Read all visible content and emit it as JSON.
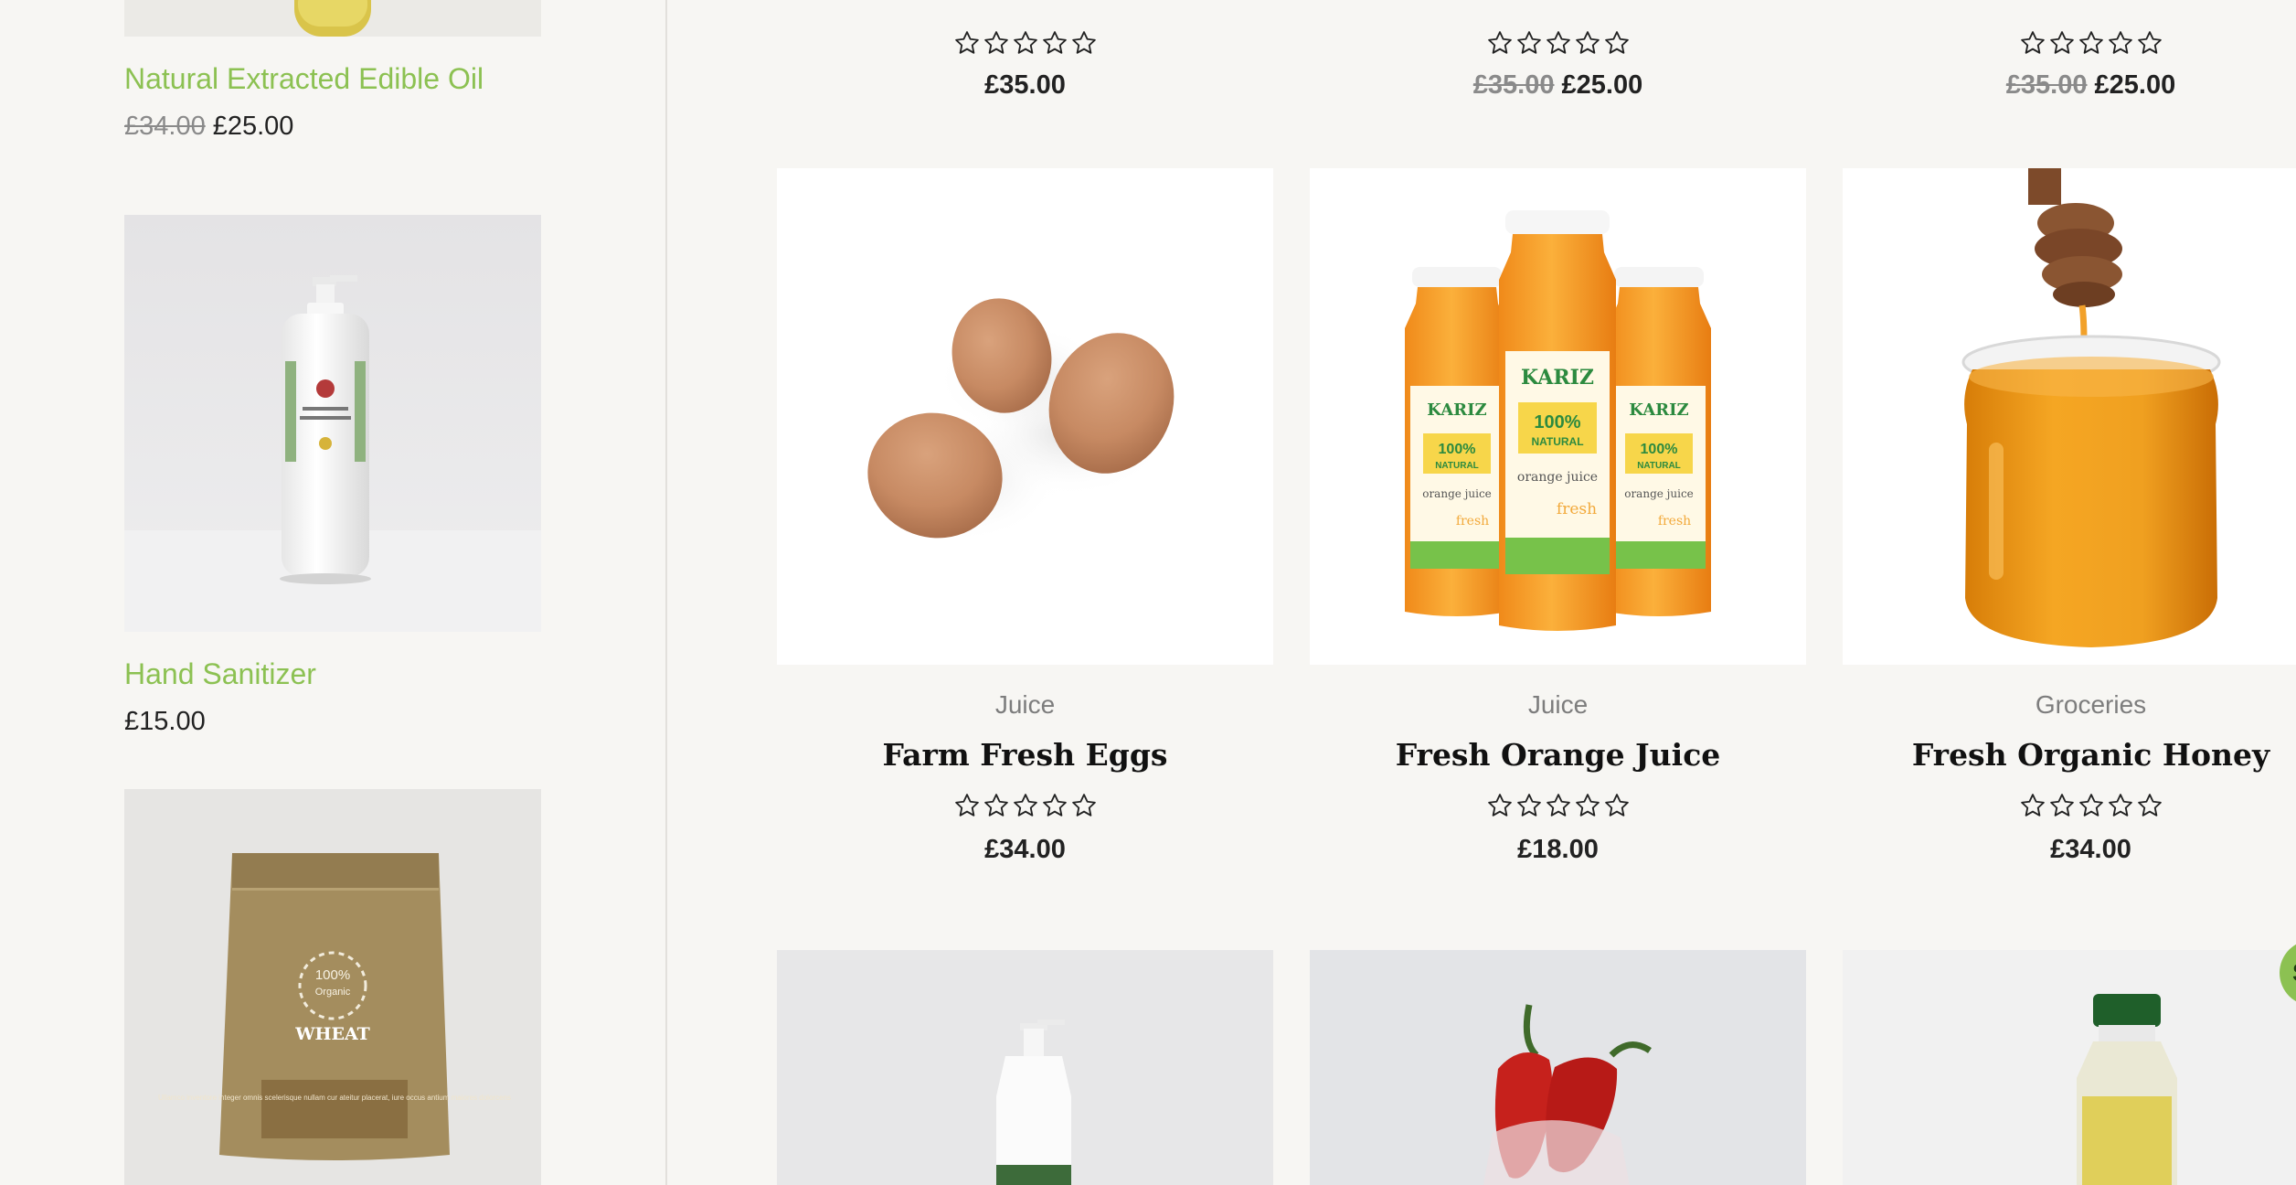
{
  "sidebar": {
    "items": [
      {
        "title": "Natural Extracted Edible Oil",
        "old_price": "£34.00",
        "price": "£25.00"
      },
      {
        "title": "Hand Sanitizer",
        "old_price": "",
        "price": "£15.00"
      },
      {
        "title": "",
        "old_price": "",
        "price": ""
      }
    ],
    "wheat_bag": {
      "badge": "100%",
      "badge_sub": "Organic",
      "label": "WHEAT",
      "small_text": "Ullamco inventore integer omnis scelerisque nullam cur ateitur placerat, iure occus antium maiores dolorcens"
    }
  },
  "top_row": [
    {
      "old_price": "",
      "price": "£35.00"
    },
    {
      "old_price": "£35.00",
      "price": "£25.00"
    },
    {
      "old_price": "£35.00",
      "price": "£25.00"
    }
  ],
  "products": [
    {
      "category": "Juice",
      "title": "Farm Fresh Eggs",
      "price": "£34.00"
    },
    {
      "category": "Juice",
      "title": "Fresh Orange Juice",
      "price": "£18.00"
    },
    {
      "category": "Groceries",
      "title": "Fresh Organic Honey",
      "price": "£34.00"
    }
  ],
  "juice_label": {
    "brand": "KARIZ",
    "natural": "100%",
    "natural_sub": "NATURAL",
    "flavor": "orange juice",
    "fresh": "fresh"
  },
  "badge": {
    "text": "S"
  },
  "colors": {
    "accent": "#8cc152",
    "background": "#f7f6f3"
  }
}
